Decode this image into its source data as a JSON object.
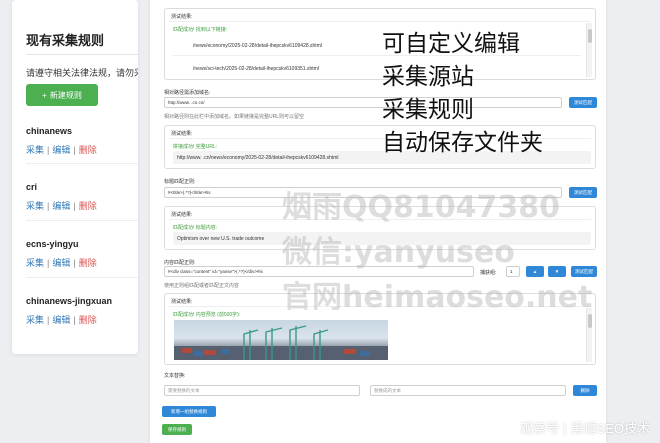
{
  "sidebar": {
    "title": "现有采集规则",
    "notice": "请遵守相关法律法规，请勿采集",
    "new_rule_label": "新建规则",
    "rules": [
      {
        "name": "chinanews",
        "collect": "采集",
        "edit": "编辑",
        "delete": "删除"
      },
      {
        "name": "cri",
        "collect": "采集",
        "edit": "编辑",
        "delete": "删除"
      },
      {
        "name": "ecns-yingyu",
        "collect": "采集",
        "edit": "编辑",
        "delete": "删除"
      },
      {
        "name": "chinanews-jingxuan",
        "collect": "采集",
        "edit": "编辑",
        "delete": "删除"
      }
    ]
  },
  "main": {
    "test1": {
      "label": "测试结果:",
      "status": "匹配成功! 找到以下链接:",
      "urls": [
        "/news/economy/2025-02-28/detail-ihepcskv6109428.shtml",
        "/news/sci-tech/2025-02-28/detail-ihepcskv6109351.shtml"
      ]
    },
    "link_section": {
      "label": "相对路径需添加域名:",
      "input_value": "http://www.        .cn.cn/",
      "hint": "相对路径则在此栏中添加域名。如果链接是完整URL则可以留空",
      "test_button": "测试匹配"
    },
    "test2": {
      "label": "测试结果:",
      "status": "拼接成功! 完整URL:",
      "value": "http://www.         .cn/news/economy/2025-02-28/detail-ihepcskv6109428.shtml"
    },
    "title_section": {
      "label": "标题匹配正则:",
      "input_value": "#<title>(.*?)</title>#is",
      "test_button": "测试匹配"
    },
    "test3": {
      "label": "测试结果:",
      "status": "匹配成功! 标题内容:",
      "value": "Optimism over new U.S. trade outcome"
    },
    "content_section": {
      "label": "内容匹配正则:",
      "input_value": "#<div class=\"content\" id=\"yanse\">(.*?)</div>#is",
      "group_label": "捕获组:",
      "group_value": "1",
      "hint": "使用正则组匹配或者匹配正文内容",
      "test_button": "测试匹配"
    },
    "test4": {
      "label": "测试结果:",
      "status": "匹配成功! 内容预览 (前500字):"
    },
    "replace_section": {
      "label": "文本替换:",
      "placeholder_find": "需要替换的文本",
      "placeholder_replace": "替换成的文本",
      "delete_button": "删除",
      "add_button": "新增一组替换规则",
      "save_button": "保存规则"
    }
  },
  "captions": [
    "可自定义编辑",
    "采集源站",
    "采集规则",
    "自动保存文件夹"
  ],
  "watermark": [
    "烟雨QQ81047380",
    "微信:yanyuseo",
    "官网heimaoseo.net"
  ],
  "credit": {
    "source": "观察号",
    "author": "黑帽SEO技术"
  },
  "colors": {
    "green": "#4caf50",
    "blue": "#2f87d8",
    "link": "#337ab7",
    "delete": "#d9534f"
  }
}
